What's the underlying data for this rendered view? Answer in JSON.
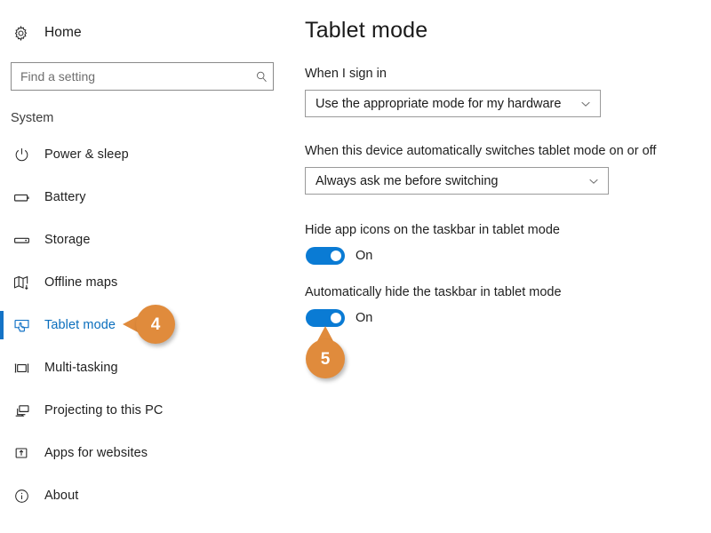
{
  "sidebar": {
    "home": {
      "label": "Home",
      "icon": "gear-icon"
    },
    "search": {
      "placeholder": "Find a setting",
      "value": "",
      "icon": "search-icon"
    },
    "section_label": "System",
    "items": [
      {
        "label": "Power & sleep",
        "icon": "power-icon",
        "selected": false
      },
      {
        "label": "Battery",
        "icon": "battery-icon",
        "selected": false
      },
      {
        "label": "Storage",
        "icon": "storage-icon",
        "selected": false
      },
      {
        "label": "Offline maps",
        "icon": "map-icon",
        "selected": false
      },
      {
        "label": "Tablet mode",
        "icon": "tablet-mode-icon",
        "selected": true
      },
      {
        "label": "Multi-tasking",
        "icon": "multitasking-icon",
        "selected": false
      },
      {
        "label": "Projecting to this PC",
        "icon": "projecting-icon",
        "selected": false
      },
      {
        "label": "Apps for websites",
        "icon": "apps-for-websites-icon",
        "selected": false
      },
      {
        "label": "About",
        "icon": "info-icon",
        "selected": false
      }
    ]
  },
  "main": {
    "title": "Tablet mode",
    "sign_in": {
      "label": "When I sign in",
      "value": "Use the appropriate mode for my hardware"
    },
    "auto_switch": {
      "label": "When this device automatically switches tablet mode on or off",
      "value": "Always ask me before switching"
    },
    "hide_app_icons": {
      "label": "Hide app icons on the taskbar in tablet mode",
      "state": "On"
    },
    "auto_hide_taskbar": {
      "label": "Automatically hide the taskbar in tablet mode",
      "state": "On"
    }
  },
  "callouts": [
    {
      "number": "4",
      "target": "Tablet mode"
    },
    {
      "number": "5",
      "target": "Automatically hide the taskbar in tablet mode"
    }
  ],
  "colors": {
    "accent_blue": "#0a7bd4",
    "selected_text": "#0a6ebd",
    "callout_orange": "#e08b3c"
  }
}
